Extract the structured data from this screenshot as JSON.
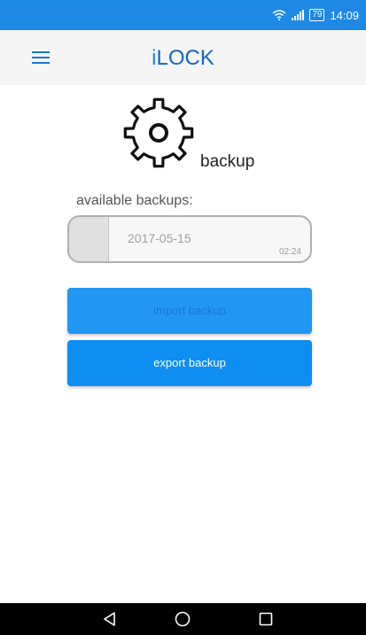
{
  "status_bar": {
    "wifi_icon": "wifi-icon",
    "signal_icon": "signal-icon",
    "battery": "79",
    "time": "14:09",
    "color": "#1e88e5"
  },
  "app_bar": {
    "title_first": "i",
    "title_rest": "LOCK",
    "menu_icon": "hamburger-menu-icon"
  },
  "page": {
    "icon": "gear-icon",
    "heading": "backup",
    "available_label": "available backups:"
  },
  "backups": [
    {
      "date": "2017-05-15",
      "time": "02:24"
    }
  ],
  "buttons": {
    "import_label": "import backup",
    "export_label": "export backup",
    "accent": "#2196f3"
  },
  "nav_bar": {
    "back_icon": "back-triangle-icon",
    "home_icon": "home-circle-icon",
    "recent_icon": "recent-apps-square-icon"
  }
}
